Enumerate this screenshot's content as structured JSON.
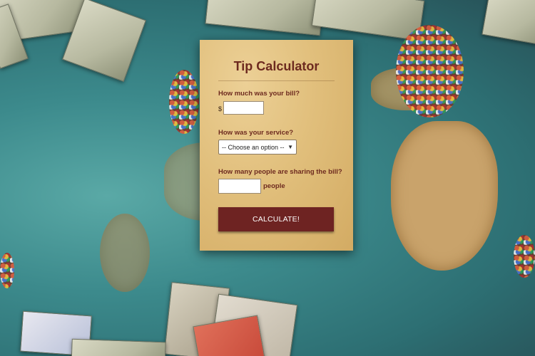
{
  "calculator": {
    "title": "Tip Calculator",
    "bill_question": "How much was your bill?",
    "currency_symbol": "$",
    "bill_value": "",
    "service_question": "How was your service?",
    "service_selected": "-- Choose an option --",
    "people_question": "How many people are sharing the bill?",
    "people_value": "",
    "people_suffix": "people",
    "calculate_label": "CALCULATE!"
  },
  "colors": {
    "accent": "#6e2322",
    "title_text": "#6d2a1f",
    "card_paper": "#e1bf7c"
  },
  "icons": {
    "select_arrow": "chevron-down-icon"
  }
}
